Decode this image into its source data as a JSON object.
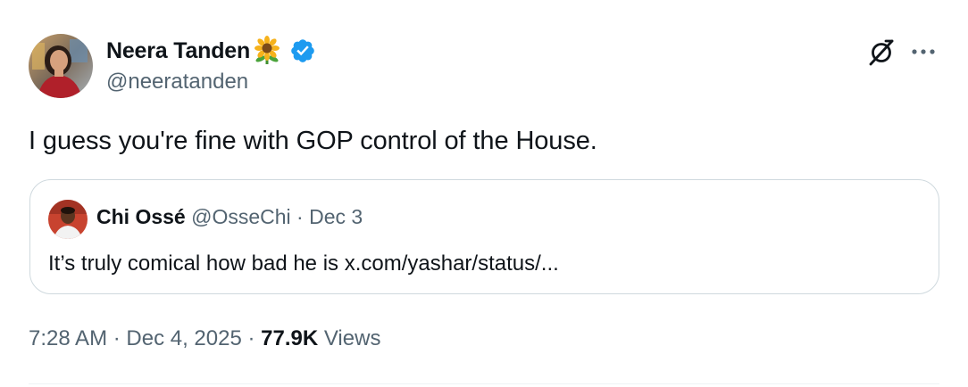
{
  "author": {
    "display_name": "Neera Tanden",
    "handle": "@neeratanden",
    "emoji": "🌻"
  },
  "tweet": {
    "text": "I guess you're fine with GOP control of the House."
  },
  "quote": {
    "display_name": "Chi Ossé",
    "handle": "@OsseChi",
    "separator": " · ",
    "date": "Dec 3",
    "text": "It’s truly comical how bad he is x.com/yashar/status/..."
  },
  "meta": {
    "time": "7:28 AM",
    "separator": " · ",
    "date": "Dec 4, 2025",
    "separator2": " · ",
    "views_count": "77.9K",
    "views_label": " Views"
  },
  "colors": {
    "primary_text": "#0f1419",
    "secondary_text": "#536471",
    "verified_blue": "#1d9bf0",
    "border": "#cfd9de"
  }
}
